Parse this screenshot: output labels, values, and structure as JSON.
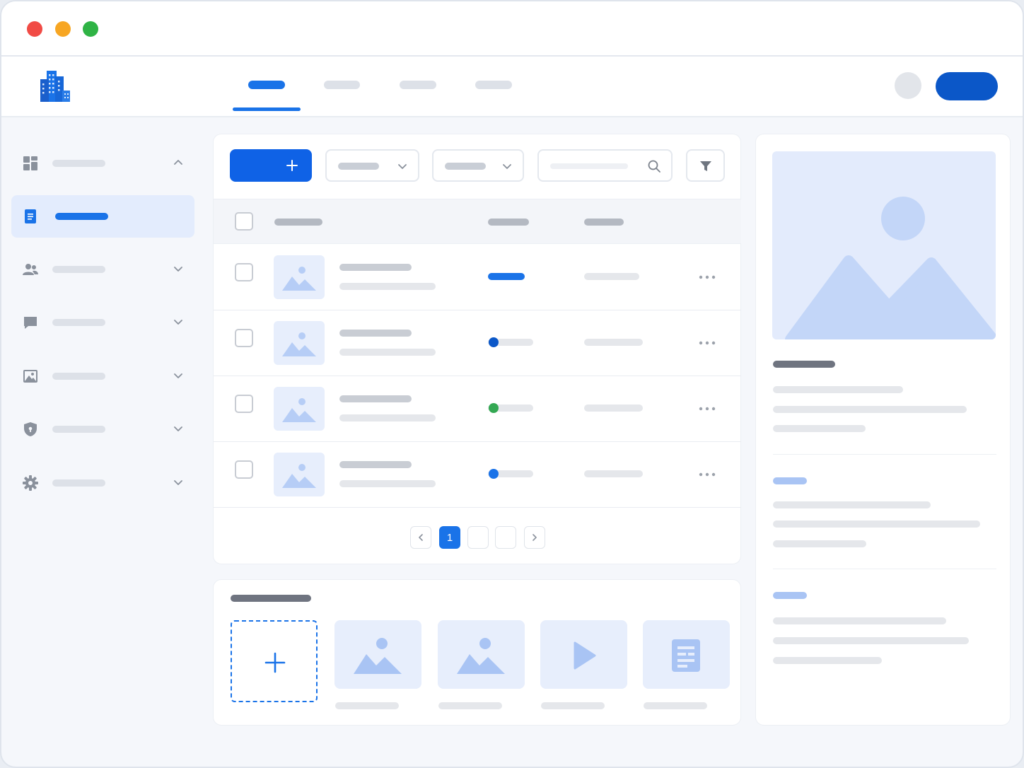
{
  "window": {
    "controls": [
      "close",
      "minimize",
      "maximize"
    ],
    "colors": {
      "close": "#f14b45",
      "minimize": "#f7a623",
      "maximize": "#2fb345"
    }
  },
  "header": {
    "logo_icon": "building-icon",
    "tabs": [
      {
        "label": "",
        "active": true
      },
      {
        "label": "",
        "active": false
      },
      {
        "label": "",
        "active": false
      },
      {
        "label": "",
        "active": false
      }
    ],
    "avatar": "user-avatar",
    "primary_action_label": ""
  },
  "sidebar": {
    "items": [
      {
        "icon": "dashboard-icon",
        "label": "",
        "expanded": true,
        "active": false
      },
      {
        "icon": "document-icon",
        "label": "",
        "active": true
      },
      {
        "icon": "users-icon",
        "label": "",
        "expanded": false
      },
      {
        "icon": "chat-icon",
        "label": "",
        "expanded": false
      },
      {
        "icon": "image-icon",
        "label": "",
        "expanded": false
      },
      {
        "icon": "shield-icon",
        "label": "",
        "expanded": false
      },
      {
        "icon": "gear-icon",
        "label": "",
        "expanded": false
      }
    ]
  },
  "toolbar": {
    "add_icon": "plus-icon",
    "filter_1_value": "",
    "filter_2_value": "",
    "search_placeholder": "",
    "filter_icon": "funnel-icon"
  },
  "table": {
    "rows": [
      {
        "status": "bar",
        "status_color": "#1a73e8"
      },
      {
        "status": "dot",
        "status_color": "#0b57c8"
      },
      {
        "status": "dot",
        "status_color": "#34a853"
      },
      {
        "status": "dot",
        "status_color": "#1a73e8"
      }
    ]
  },
  "pagination": {
    "pages": [
      "1",
      "",
      ""
    ],
    "current": "1"
  },
  "media": {
    "tiles": [
      {
        "type": "upload",
        "icon": "plus-icon"
      },
      {
        "type": "image",
        "icon": "image-icon"
      },
      {
        "type": "image",
        "icon": "image-icon"
      },
      {
        "type": "video",
        "icon": "play-icon"
      },
      {
        "type": "document",
        "icon": "document-icon"
      }
    ]
  },
  "detail_panel": {
    "preview_icon": "image-placeholder-icon"
  },
  "colors": {
    "accent": "#1a73e8",
    "accent_dark": "#0b57c8",
    "success": "#34a853",
    "light_blue": "#e7eefc"
  }
}
